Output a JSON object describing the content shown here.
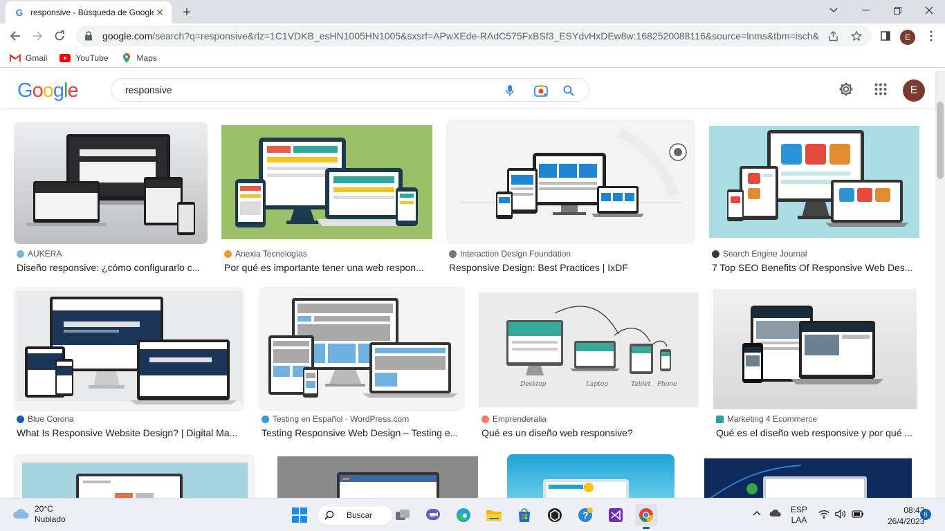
{
  "browser": {
    "tab_title": "responsive - Búsqueda de Google",
    "url_host": "google.com",
    "url_path": "/search?q=responsive&rlz=1C1VDKB_esHN1005HN1005&sxsrf=APwXEde-RAdC575FxBSf3_ESYdvHxDEw8w:1682520088116&source=lnms&tbm=isch&sa=...",
    "profile_initial": "E",
    "bookmarks": [
      {
        "label": "Gmail",
        "icon": "gmail-icon"
      },
      {
        "label": "YouTube",
        "icon": "youtube-icon"
      },
      {
        "label": "Maps",
        "icon": "maps-icon"
      }
    ]
  },
  "google": {
    "logo": "Google",
    "query": "responsive",
    "profile_initial": "E"
  },
  "results": [
    {
      "source": "AUKERA",
      "title": "Diseño responsive: ¿cómo configurarlo c...",
      "source_color": "#7fb2d9"
    },
    {
      "source": "Anexia Tecnologías",
      "title": "Por qué es importante tener una web respon...",
      "source_color": "#f29a2e"
    },
    {
      "source": "Interaction Design Foundation",
      "title": "Responsive Design: Best Practices | IxDF",
      "source_color": "#777777"
    },
    {
      "source": "Search Engine Journal",
      "title": "7 Top SEO Benefits Of Responsive Web Des...",
      "source_color": "#3b3b3b"
    },
    {
      "source": "Blue Corona",
      "title": "What Is Responsive Website Design? | Digital Ma...",
      "source_color": "#1a5fb4"
    },
    {
      "source": "Testing en Español - WordPress.com",
      "title": "Testing Responsive Web Design – Testing e...",
      "source_color": "#2f9ad6"
    },
    {
      "source": "Emprenderalia",
      "title": "Qué es un diseño web responsive?",
      "source_color": "#f27a5e"
    },
    {
      "source": "Marketing 4 Ecommerce",
      "title": "Qué es el diseño web responsive y por qué ...",
      "source_color": "#23a3a0"
    }
  ],
  "taskbar": {
    "weather_temp": "20°C",
    "weather_desc": "Nublado",
    "search_label": "Buscar",
    "lang_line1": "ESP",
    "lang_line2": "LAA",
    "time": "08:42",
    "date": "26/4/2023",
    "notifications": "6"
  }
}
